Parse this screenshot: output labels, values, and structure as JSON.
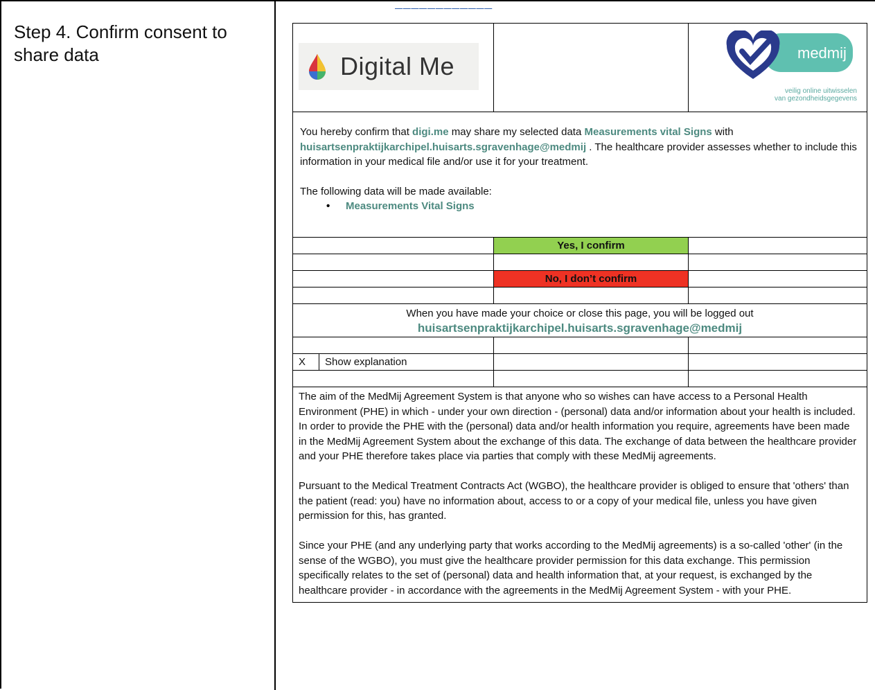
{
  "step": {
    "title": "Step 4. Confirm consent to share data"
  },
  "brand": {
    "left_logo_text": "Digital Me",
    "right_logo_text": "medmij",
    "right_logo_caption_1": "veilig online uitwisselen",
    "right_logo_caption_2": "van gezondheidsgegevens"
  },
  "consent": {
    "intro_1": "You hereby confirm that ",
    "app_name": "digi.me",
    "intro_2": " may share my selected data ",
    "data_name": "Measurements vital Signs",
    "intro_3": " with",
    "provider_email": "huisartsenpraktijkarchipel.huisarts.sgravenhage@medmij",
    "intro_4": " . The healthcare provider assesses whether to include this information in your medical file and/or use it for your treatment.",
    "available_heading": "The following data will be made available:",
    "available_items": [
      "Measurements  Vital Signs"
    ]
  },
  "actions": {
    "confirm_label": "Yes, I confirm",
    "deny_label": "No, I don’t confirm"
  },
  "logout": {
    "message": "When you have made your choice or close this page, you will be logged out",
    "email": "huisartsenpraktijkarchipel.huisarts.sgravenhage@medmij"
  },
  "explanation": {
    "checkbox_mark": "X",
    "toggle_label": "Show explanation",
    "paragraphs": [
      "The aim of the MedMij Agreement System is that anyone who so wishes can have access to a Personal Health Environment (PHE) in which - under your own direction - (personal) data and/or information about your health is included. In order to provide the PHE with the (personal) data and/or health information you require, agreements have been made in the MedMij Agreement System about the exchange of this data. The exchange of data between the healthcare provider and your PHE therefore takes place via parties that comply with these MedMij agreements.",
      "Pursuant to the Medical Treatment Contracts Act (WGBO), the healthcare provider is obliged to ensure that 'others' than the patient (read: you) have no information about, access to or a copy of your medical file, unless you have given permission for this, has granted.",
      "Since your PHE (and any underlying party that works according to the MedMij agreements) is a so-called 'other' (in the sense of the WGBO), you must give the healthcare provider permission for this data exchange. This permission specifically relates to the set of (personal) data and health information that, at your request, is exchanged by the healthcare provider - in accordance with the agreements in the MedMij Agreement System - with your PHE."
    ]
  },
  "colors": {
    "confirm_bg": "#92d050",
    "deny_bg": "#ee3224",
    "highlight_text": "#4d8a80",
    "medmij_teal": "#5fc0b0",
    "medmij_navy": "#2a3a8c"
  },
  "icons": {
    "left_logo": "colorful-drop-icon",
    "right_logo": "medmij-heart-logo"
  }
}
